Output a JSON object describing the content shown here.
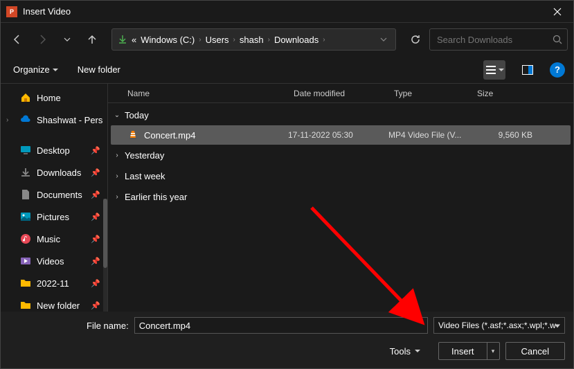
{
  "title": "Insert Video",
  "breadcrumb": {
    "drive": "Windows (C:)",
    "segments": [
      "Users",
      "shash",
      "Downloads"
    ]
  },
  "search": {
    "placeholder": "Search Downloads"
  },
  "toolbar": {
    "organize": "Organize",
    "newfolder": "New folder"
  },
  "sidebar": {
    "home": "Home",
    "onedrive": "Shashwat - Pers",
    "desktop": "Desktop",
    "downloads": "Downloads",
    "documents": "Documents",
    "pictures": "Pictures",
    "music": "Music",
    "videos": "Videos",
    "folder1": "2022-11",
    "folder2": "New folder"
  },
  "columns": {
    "name": "Name",
    "date": "Date modified",
    "type": "Type",
    "size": "Size"
  },
  "groups": {
    "today": "Today",
    "yesterday": "Yesterday",
    "lastweek": "Last week",
    "earlier": "Earlier this year"
  },
  "file": {
    "name": "Concert.mp4",
    "date": "17-11-2022 05:30",
    "type": "MP4 Video File (V...",
    "size": "9,560 KB"
  },
  "footer": {
    "filename_label": "File name:",
    "filename_value": "Concert.mp4",
    "filetype": "Video Files (*.asf;*.asx;*.wpl;*.w",
    "tools": "Tools",
    "insert": "Insert",
    "cancel": "Cancel"
  }
}
